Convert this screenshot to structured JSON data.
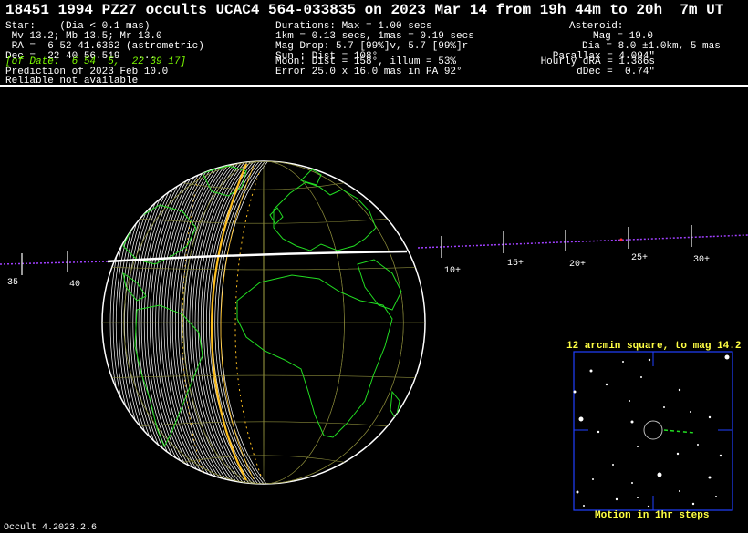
{
  "title": "18451 1994 PZ27 occults UCAC4 564-033835 on 2023 Mar 14 from 19h 44m to 20h  7m UT",
  "star": {
    "line1": "Star:    (Dia < 0.1 mas)",
    "line2": " Mv 13.2; Mb 13.5; Mr 13.0",
    "line3": " RA =  6 52 41.6362 (astrometric)",
    "line4": "Dec =  22 40 56.519   ...",
    "line5": "[of Date:  6 54  5,  22 39 17]",
    "line6": "Prediction of 2023 Feb 10.0",
    "line7": "Reliable not available"
  },
  "event": {
    "line1": "Durations: Max = 1.00 secs",
    "line2": "1km = 0.13 secs, 1mas = 0.19 secs",
    "line3": "Mag Drop: 5.7 [99%]v, 5.7 [99%]r",
    "line4": "Sun : Dist = 108°",
    "line5": "Moon: Dist = 158°, illum = 53%",
    "line6": "Error 25.0 x 16.0 mas in PA 92°"
  },
  "asteroid": {
    "line1": "Asteroid:",
    "line2": "Mag = 19.0",
    "line3": "Dia = 8.0 ±1.0km, 5 mas",
    "line4": "Parallax = 4.094\"",
    "line5": "Hourly dRA = 1.386s",
    "line6": "dDec =  0.74\""
  },
  "path_ticks": [
    "35",
    "40",
    "10+",
    "15+",
    "20+",
    "25+",
    "30+"
  ],
  "inset": {
    "top_label": "12 arcmin square, to mag 14.2",
    "bottom_label": "Motion in 1hr steps"
  },
  "footer": "Occult 4.2023.2.6",
  "colors": {
    "globe_green": "#22dd22",
    "track_purple": "#a040ff",
    "shadow_yellow": "#ffc020",
    "inset_blue": "#2040ff",
    "label_yellow": "#ffff44"
  }
}
